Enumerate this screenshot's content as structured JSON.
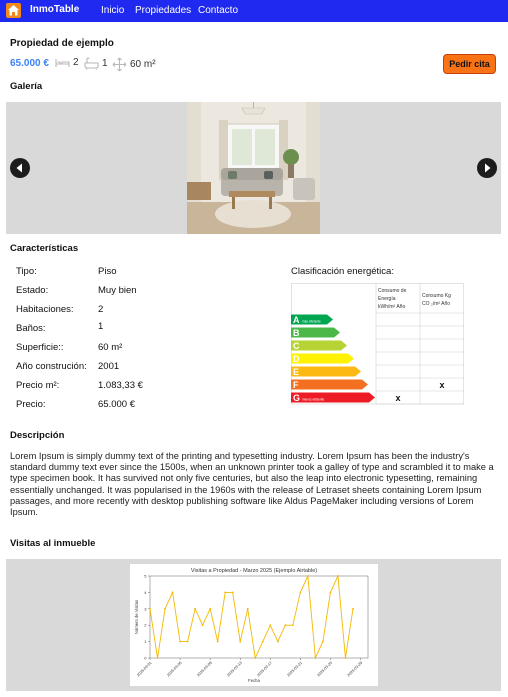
{
  "navbar": {
    "brand": "InmoTable",
    "links": [
      "Inicio",
      "Propiedades",
      "Contacto"
    ],
    "color": "#1f29f0"
  },
  "property": {
    "title": "Propiedad de ejemplo",
    "price": "65.000 €",
    "rooms": "2",
    "baths": "1",
    "area": "60 m²",
    "cta_label": "Pedir cita"
  },
  "gallery": {
    "heading": "Galería"
  },
  "features": {
    "heading": "Características",
    "items": [
      {
        "label": "Tipo:",
        "value": "Piso"
      },
      {
        "label": "Estado:",
        "value": "Muy bien"
      },
      {
        "label": "Habitaciones:",
        "value": "2"
      },
      {
        "label": "Baños:",
        "value": "1"
      },
      {
        "label": "Superficie::",
        "value": "60 m²"
      },
      {
        "label": "Año construción:",
        "value": "2001"
      },
      {
        "label": "Precio m²:",
        "value": "1.083,33 €"
      },
      {
        "label": "Precio:",
        "value": "65.000 €"
      }
    ]
  },
  "energy": {
    "title": "Clasificación energética:",
    "col1_header": [
      "Consumo de",
      "Energía",
      "kWh/m² Año"
    ],
    "col2_header": [
      "Consumo Kg",
      "CO ₂/m² Año"
    ],
    "letters": [
      "A",
      "B",
      "C",
      "D",
      "E",
      "F",
      "G"
    ],
    "top_note": "más eficiente",
    "bottom_note": "menos eficiente",
    "mark": "x",
    "energy_rating": "G",
    "co2_rating": "F",
    "colors": [
      "#00a650",
      "#4cb848",
      "#b6d433",
      "#fff200",
      "#fdb913",
      "#f37021",
      "#ed1c24"
    ]
  },
  "description": {
    "heading": "Descripción",
    "text": "Lorem Ipsum is simply dummy text of the printing and typesetting industry. Lorem Ipsum has been the industry's standard dummy text ever since the 1500s, when an unknown printer took a galley of type and scrambled it to make a type specimen book. It has survived not only five centuries, but also the leap into electronic typesetting, remaining essentially unchanged. It was popularised in the 1960s with the release of Letraset sheets containing Lorem Ipsum passages, and more recently with desktop publishing software like Aldus PageMaker including versions of Lorem Ipsum."
  },
  "visits": {
    "heading": "Visitas al inmueble"
  },
  "chart_data": {
    "type": "line",
    "title": "Visitas a Propiedad - Marzo 2025 (Ejemplo Airtable)",
    "xlabel": "Fecha",
    "ylabel": "Número de Visitas",
    "x": [
      "2025-03-01",
      "2025-03-02",
      "2025-03-03",
      "2025-03-04",
      "2025-03-05",
      "2025-03-06",
      "2025-03-07",
      "2025-03-08",
      "2025-03-09",
      "2025-03-10",
      "2025-03-11",
      "2025-03-12",
      "2025-03-13",
      "2025-03-14",
      "2025-03-15",
      "2025-03-16",
      "2025-03-17",
      "2025-03-18",
      "2025-03-19",
      "2025-03-20",
      "2025-03-21",
      "2025-03-22",
      "2025-03-23",
      "2025-03-24",
      "2025-03-25",
      "2025-03-26",
      "2025-03-27",
      "2025-03-28",
      "2025-03-29",
      "2025-03-30"
    ],
    "y": [
      3,
      0,
      3,
      4,
      1,
      1,
      3,
      2,
      3,
      1,
      4,
      4,
      1,
      3,
      0,
      1,
      2,
      1,
      2,
      2,
      4,
      5,
      0,
      1,
      4,
      5,
      0,
      3
    ],
    "x_ticks": [
      "2025-03-01",
      "2025-03-05",
      "2025-03-09",
      "2025-03-13",
      "2025-03-17",
      "2025-03-21",
      "2025-03-25",
      "2025-03-29"
    ],
    "y_ticks": [
      0,
      1,
      2,
      3,
      4,
      5
    ],
    "ylim": [
      0,
      5
    ],
    "line_color": "#f5b800",
    "grid": false
  }
}
